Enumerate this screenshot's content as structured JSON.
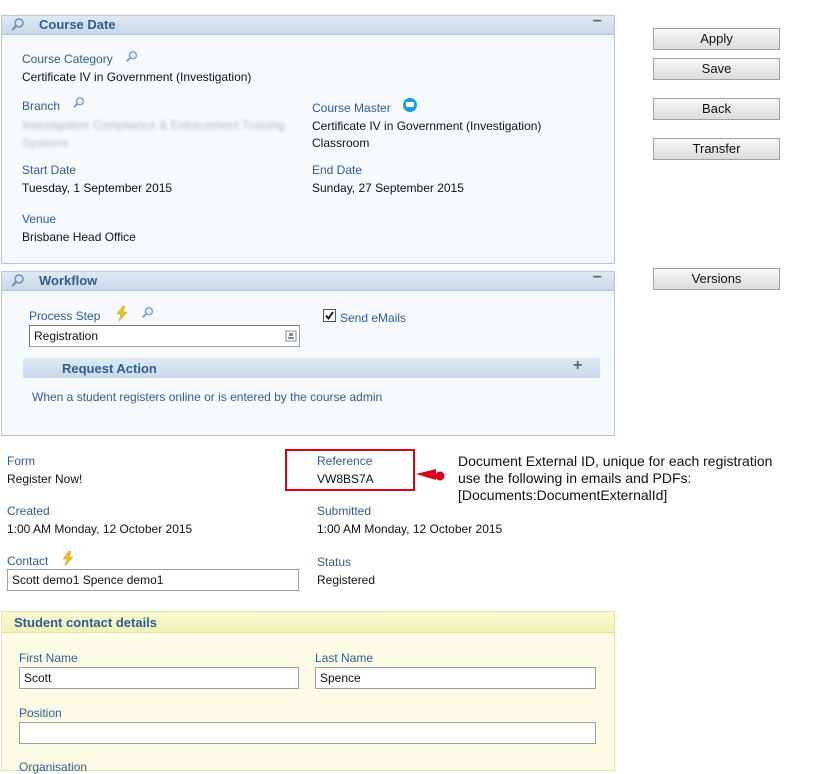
{
  "course_date": {
    "title": "Course Date",
    "collapse": "−",
    "category_label": "Course Category",
    "category_value": "Certificate IV in Government (Investigation)",
    "branch_label": "Branch",
    "branch_value": "Investigation Compliance & Enforcement Training Systems",
    "master_label": "Course Master",
    "master_value1": "Certificate IV in Government (Investigation)",
    "master_value2": "Classroom",
    "start_label": "Start Date",
    "start_value": "Tuesday, 1 September 2015",
    "end_label": "End Date",
    "end_value": "Sunday, 27 September 2015",
    "venue_label": "Venue",
    "venue_value": "Brisbane Head Office"
  },
  "buttons": {
    "apply": "Apply",
    "save": "Save",
    "back": "Back",
    "transfer": "Transfer",
    "versions": "Versions"
  },
  "workflow": {
    "title": "Workflow",
    "collapse": "−",
    "process_label": "Process Step",
    "process_value": "Registration",
    "send_emails_label": "Send eMails",
    "send_emails_checked": true,
    "request_action_title": "Request Action",
    "expand": "+",
    "description": "When a student registers online or is entered by the course admin"
  },
  "registration": {
    "form_label": "Form",
    "form_value": "Register Now!",
    "reference_label": "Reference",
    "reference_value": "VW8BS7A",
    "created_label": "Created",
    "created_value": "1:00 AM Monday, 12 October 2015",
    "submitted_label": "Submitted",
    "submitted_value": "1:00 AM Monday, 12 October 2015",
    "contact_label": "Contact",
    "contact_value": "Scott demo1 Spence demo1",
    "status_label": "Status",
    "status_value": "Registered"
  },
  "annotation": {
    "line1": "Document External ID, unique for each registration",
    "line2": "use the following in emails and PDFs:",
    "line3": "[Documents:DocumentExternalId]",
    "color": "#d9001b"
  },
  "student": {
    "title": "Student contact details",
    "first_label": "First Name",
    "first_value": "Scott",
    "last_label": "Last Name",
    "last_value": "Spence",
    "position_label": "Position",
    "position_value": "",
    "org_label": "Organisation"
  },
  "icons": {
    "search": "magnifier-icon",
    "lightning": "lightning-icon",
    "info": "info-bubble-icon",
    "lookup": "lookup-icon"
  }
}
